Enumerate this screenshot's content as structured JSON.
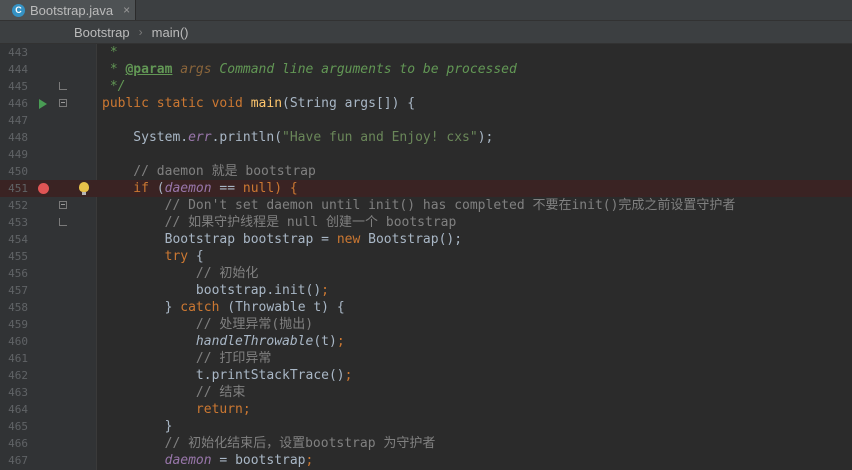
{
  "tab": {
    "filename": "Bootstrap.java",
    "icon": "java-class-icon",
    "close": "×"
  },
  "breadcrumb": {
    "class": "Bootstrap",
    "method": "main()",
    "separator": "›"
  },
  "colors": {
    "keyword": "#cc7832",
    "string": "#6a8759",
    "comment": "#808080",
    "doc": "#629755",
    "field": "#9876aa",
    "background": "#2b2b2b",
    "breakpoint_line": "#3a2323"
  },
  "lines": [
    {
      "num": "443",
      "c1": "",
      "c2": " *",
      "c3": "",
      "c4": "",
      "c5": ""
    },
    {
      "num": "444",
      "c1": " * ",
      "c2": "@param",
      "c3": " args ",
      "c4": "Command line arguments to be processed",
      "c5": ""
    },
    {
      "num": "445",
      "c1": " */",
      "c2": "",
      "c3": "",
      "c4": "",
      "c5": ""
    },
    {
      "num": "446",
      "c1": "public static void ",
      "c2": "main",
      "c3": "(String args[]) {",
      "c4": "",
      "c5": ""
    },
    {
      "num": "447",
      "c1": "",
      "c2": "",
      "c3": "",
      "c4": "",
      "c5": ""
    },
    {
      "num": "448",
      "c1": "    System.",
      "c2": "err",
      "c3": ".println(",
      "c4": "\"Have fun and Enjoy! cxs\"",
      "c5": ");"
    },
    {
      "num": "449",
      "c1": "",
      "c2": "",
      "c3": "",
      "c4": "",
      "c5": ""
    },
    {
      "num": "450",
      "c1": "    // daemon 就是 bootstrap",
      "c2": "",
      "c3": "",
      "c4": "",
      "c5": ""
    },
    {
      "num": "451",
      "c1": "    if ",
      "c2": "(",
      "c3": "daemon",
      "c4": " == ",
      "c5": "null) {"
    },
    {
      "num": "452",
      "c1": "        // Don't set daemon until init() has completed 不要在init()完成之前设置守护者",
      "c2": "",
      "c3": "",
      "c4": "",
      "c5": ""
    },
    {
      "num": "453",
      "c1": "        // 如果守护线程是 null 创建一个 bootstrap",
      "c2": "",
      "c3": "",
      "c4": "",
      "c5": ""
    },
    {
      "num": "454",
      "c1": "        Bootstrap bootstrap = ",
      "c2": "new",
      "c3": " Bootstrap();",
      "c4": "",
      "c5": ""
    },
    {
      "num": "455",
      "c1": "        ",
      "c2": "try",
      "c3": " {",
      "c4": "",
      "c5": ""
    },
    {
      "num": "456",
      "c1": "            // 初始化",
      "c2": "",
      "c3": "",
      "c4": "",
      "c5": ""
    },
    {
      "num": "457",
      "c1": "            bootstrap.init()",
      "c2": ";",
      "c3": "",
      "c4": "",
      "c5": ""
    },
    {
      "num": "458",
      "c1": "        } ",
      "c2": "catch",
      "c3": " (Throwable t) {",
      "c4": "",
      "c5": ""
    },
    {
      "num": "459",
      "c1": "            // 处理异常(抛出)",
      "c2": "",
      "c3": "",
      "c4": "",
      "c5": ""
    },
    {
      "num": "460",
      "c1": "            ",
      "c2": "handleThrowable",
      "c3": "(t)",
      "c4": ";",
      "c5": ""
    },
    {
      "num": "461",
      "c1": "            // 打印异常",
      "c2": "",
      "c3": "",
      "c4": "",
      "c5": ""
    },
    {
      "num": "462",
      "c1": "            t.printStackTrace()",
      "c2": ";",
      "c3": "",
      "c4": "",
      "c5": ""
    },
    {
      "num": "463",
      "c1": "            // 结束",
      "c2": "",
      "c3": "",
      "c4": "",
      "c5": ""
    },
    {
      "num": "464",
      "c1": "            ",
      "c2": "return;",
      "c3": "",
      "c4": "",
      "c5": ""
    },
    {
      "num": "465",
      "c1": "        }",
      "c2": "",
      "c3": "",
      "c4": "",
      "c5": ""
    },
    {
      "num": "466",
      "c1": "        // 初始化结束后，设置bootstrap 为守护者",
      "c2": "",
      "c3": "",
      "c4": "",
      "c5": ""
    },
    {
      "num": "467",
      "c1": "        ",
      "c2": "daemon",
      "c3": " = bootstrap",
      "c4": ";",
      "c5": ""
    }
  ]
}
